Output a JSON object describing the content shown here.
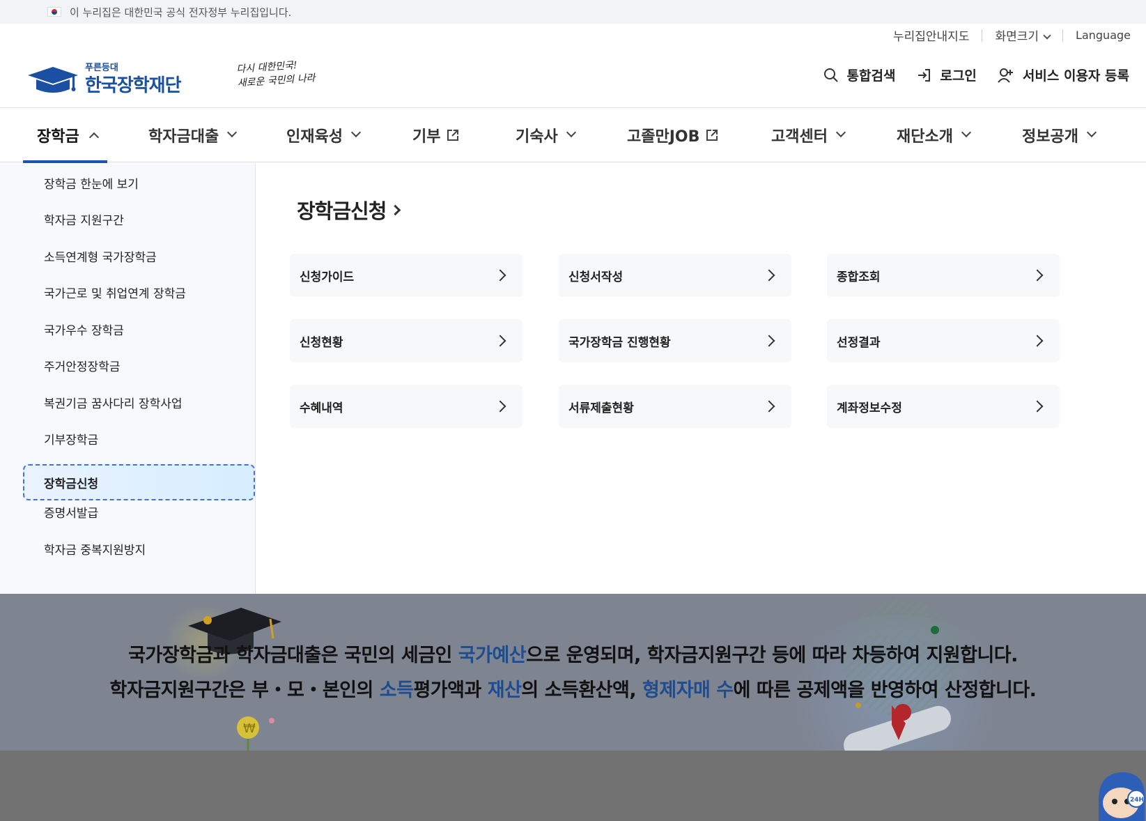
{
  "gov_banner": {
    "text": "이 누리집은 대한민국 공식 전자정부 누리집입니다."
  },
  "utility": {
    "sitemap": "누리집안내지도",
    "font_size": "화면크기",
    "language": "Language"
  },
  "logo": {
    "sub": "푸른등대",
    "name": "한국장학재단",
    "slogan_line1": "다시 대한민국!",
    "slogan_line2": "새로운 국민의 나라"
  },
  "actions": {
    "search": "통합검색",
    "login": "로그인",
    "register": "서비스 이용자 등록"
  },
  "gnb": [
    {
      "label": "장학금"
    },
    {
      "label": "학자금대출"
    },
    {
      "label": "인재육성"
    },
    {
      "label": "기부"
    },
    {
      "label": "기숙사"
    },
    {
      "label": "고졸만JOB"
    },
    {
      "label": "고객센터"
    },
    {
      "label": "재단소개"
    },
    {
      "label": "정보공개"
    }
  ],
  "sidebar": {
    "items": [
      {
        "label": "장학금 한눈에 보기"
      },
      {
        "label": "학자금 지원구간"
      },
      {
        "label": "소득연계형 국가장학금"
      },
      {
        "label": "국가근로 및 취업연계 장학금"
      },
      {
        "label": "국가우수 장학금"
      },
      {
        "label": "주거안정장학금"
      },
      {
        "label": "복권기금 꿈사다리 장학사업"
      },
      {
        "label": "기부장학금"
      },
      {
        "label": "장학금신청"
      },
      {
        "label": "증명서발급"
      },
      {
        "label": "학자금 중복지원방지"
      }
    ],
    "active_index": 8
  },
  "main": {
    "title": "장학금신청",
    "cards": [
      {
        "label": "신청가이드"
      },
      {
        "label": "신청서작성"
      },
      {
        "label": "종합조회"
      },
      {
        "label": "신청현황"
      },
      {
        "label": "국가장학금 진행현황"
      },
      {
        "label": "선정결과"
      },
      {
        "label": "수혜내역"
      },
      {
        "label": "서류제출현황"
      },
      {
        "label": "계좌정보수정"
      }
    ]
  },
  "notice": {
    "l1_a": "국가장학금과 학자금대출은 국민의 세금인 ",
    "l1_hl": "국가예산",
    "l1_b": "으로 운영되며, 학자금지원구간 등에 따라 차등하여 지원합니다.",
    "l2_a": "학자금지원구간은 부・모・본인의 ",
    "l2_hl1": "소득",
    "l2_b": "평가액과 ",
    "l2_hl2": "재산",
    "l2_c": "의 소득환산액, ",
    "l2_hl3": "형제자매 수",
    "l2_d": "에 따른 공제액을 반영하여 산정합니다."
  },
  "chatbot": {
    "badge": "24H"
  },
  "colors": {
    "accent": "#1a56b0",
    "logo_blue": "#1a4fa3",
    "highlight": "#1f4c8f",
    "notice_bg": "#7e8591"
  }
}
